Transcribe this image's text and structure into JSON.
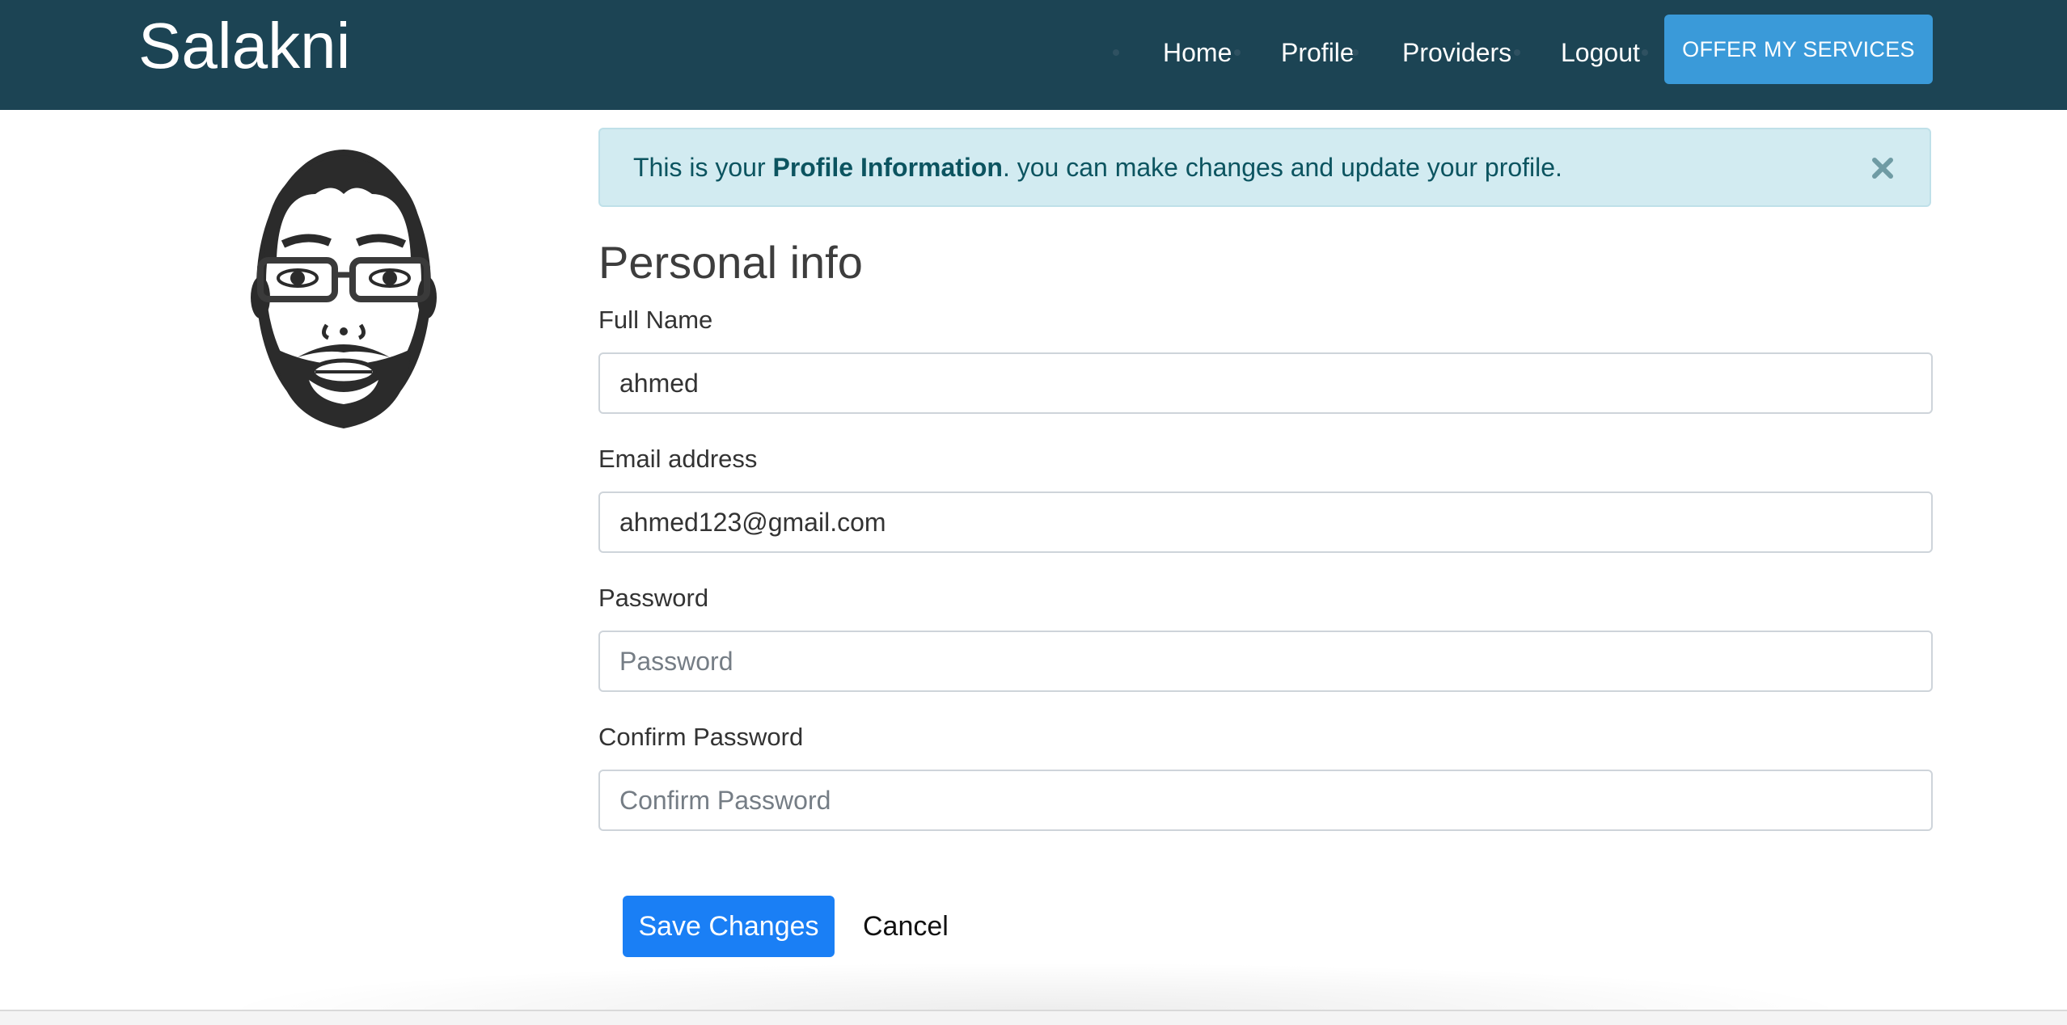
{
  "navbar": {
    "brand": "Salakni",
    "links": [
      "Home",
      "Profile",
      "Providers",
      "Logout"
    ],
    "cta_label": "OFFER MY SERVICES",
    "background": "#1c4454",
    "cta_color": "#3a9ad9"
  },
  "avatar": {
    "icon": "bearded-man-with-glasses-avatar"
  },
  "alert": {
    "prefix": "This is your ",
    "emphasis": "Profile Information",
    "suffix": ". you can make changes and update your profile.",
    "close_icon": "close-icon",
    "background": "#d2ebf1"
  },
  "form": {
    "title": "Personal info",
    "fields": [
      {
        "label": "Full Name",
        "value": "ahmed",
        "placeholder": ""
      },
      {
        "label": "Email address",
        "value": "ahmed123@gmail.com",
        "placeholder": ""
      },
      {
        "label": "Password",
        "value": "",
        "placeholder": "Password"
      },
      {
        "label": "Confirm Password",
        "value": "",
        "placeholder": "Confirm Password"
      }
    ],
    "save_label": "Save Changes",
    "cancel_label": "Cancel",
    "save_color": "#1a7ff5"
  }
}
